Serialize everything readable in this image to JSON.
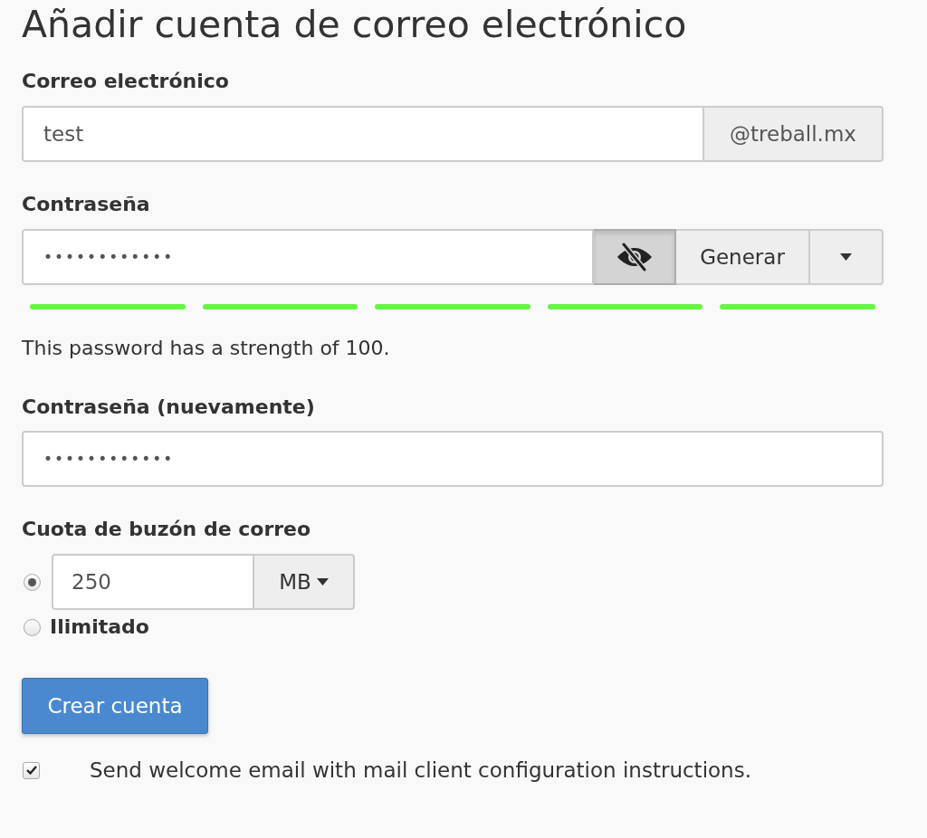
{
  "title": "Añadir cuenta de correo electrónico",
  "email": {
    "label": "Correo electrónico",
    "value": "test",
    "domain": "@treball.mx"
  },
  "password": {
    "label": "Contraseña",
    "value": "••••••••••••",
    "visibility_toggle": {
      "pressed": true
    },
    "generate_button": "Generar",
    "strength_segments": [
      {
        "filled": true
      },
      {
        "filled": true
      },
      {
        "filled": true
      },
      {
        "filled": true
      },
      {
        "filled": true
      }
    ],
    "strength_text": "This password has a strength of 100."
  },
  "password_confirm": {
    "label": "Contraseña (nuevamente)",
    "value": "••••••••••••"
  },
  "quota": {
    "label": "Cuota de buzón de correo",
    "options": [
      {
        "kind": "amount",
        "selected": true,
        "value": "250",
        "unit": "MB"
      },
      {
        "kind": "unlimited",
        "selected": false,
        "label": "Ilimitado"
      }
    ]
  },
  "submit_button": "Crear cuenta",
  "welcome_email": {
    "checked": true,
    "label": "Send welcome email with mail client configuration instructions."
  }
}
